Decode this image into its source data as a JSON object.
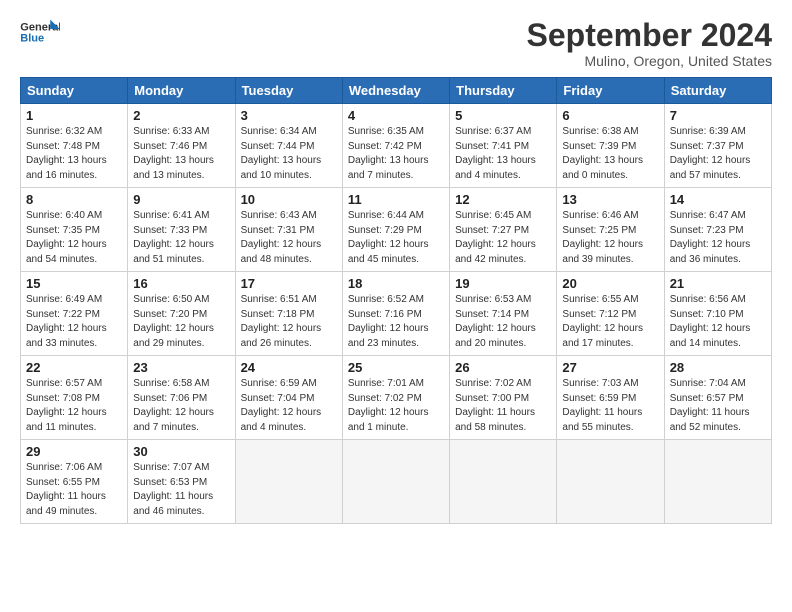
{
  "header": {
    "logo_general": "General",
    "logo_blue": "Blue",
    "month_title": "September 2024",
    "location": "Mulino, Oregon, United States"
  },
  "weekdays": [
    "Sunday",
    "Monday",
    "Tuesday",
    "Wednesday",
    "Thursday",
    "Friday",
    "Saturday"
  ],
  "weeks": [
    [
      {
        "day": "1",
        "info": "Sunrise: 6:32 AM\nSunset: 7:48 PM\nDaylight: 13 hours\nand 16 minutes."
      },
      {
        "day": "2",
        "info": "Sunrise: 6:33 AM\nSunset: 7:46 PM\nDaylight: 13 hours\nand 13 minutes."
      },
      {
        "day": "3",
        "info": "Sunrise: 6:34 AM\nSunset: 7:44 PM\nDaylight: 13 hours\nand 10 minutes."
      },
      {
        "day": "4",
        "info": "Sunrise: 6:35 AM\nSunset: 7:42 PM\nDaylight: 13 hours\nand 7 minutes."
      },
      {
        "day": "5",
        "info": "Sunrise: 6:37 AM\nSunset: 7:41 PM\nDaylight: 13 hours\nand 4 minutes."
      },
      {
        "day": "6",
        "info": "Sunrise: 6:38 AM\nSunset: 7:39 PM\nDaylight: 13 hours\nand 0 minutes."
      },
      {
        "day": "7",
        "info": "Sunrise: 6:39 AM\nSunset: 7:37 PM\nDaylight: 12 hours\nand 57 minutes."
      }
    ],
    [
      {
        "day": "8",
        "info": "Sunrise: 6:40 AM\nSunset: 7:35 PM\nDaylight: 12 hours\nand 54 minutes."
      },
      {
        "day": "9",
        "info": "Sunrise: 6:41 AM\nSunset: 7:33 PM\nDaylight: 12 hours\nand 51 minutes."
      },
      {
        "day": "10",
        "info": "Sunrise: 6:43 AM\nSunset: 7:31 PM\nDaylight: 12 hours\nand 48 minutes."
      },
      {
        "day": "11",
        "info": "Sunrise: 6:44 AM\nSunset: 7:29 PM\nDaylight: 12 hours\nand 45 minutes."
      },
      {
        "day": "12",
        "info": "Sunrise: 6:45 AM\nSunset: 7:27 PM\nDaylight: 12 hours\nand 42 minutes."
      },
      {
        "day": "13",
        "info": "Sunrise: 6:46 AM\nSunset: 7:25 PM\nDaylight: 12 hours\nand 39 minutes."
      },
      {
        "day": "14",
        "info": "Sunrise: 6:47 AM\nSunset: 7:23 PM\nDaylight: 12 hours\nand 36 minutes."
      }
    ],
    [
      {
        "day": "15",
        "info": "Sunrise: 6:49 AM\nSunset: 7:22 PM\nDaylight: 12 hours\nand 33 minutes."
      },
      {
        "day": "16",
        "info": "Sunrise: 6:50 AM\nSunset: 7:20 PM\nDaylight: 12 hours\nand 29 minutes."
      },
      {
        "day": "17",
        "info": "Sunrise: 6:51 AM\nSunset: 7:18 PM\nDaylight: 12 hours\nand 26 minutes."
      },
      {
        "day": "18",
        "info": "Sunrise: 6:52 AM\nSunset: 7:16 PM\nDaylight: 12 hours\nand 23 minutes."
      },
      {
        "day": "19",
        "info": "Sunrise: 6:53 AM\nSunset: 7:14 PM\nDaylight: 12 hours\nand 20 minutes."
      },
      {
        "day": "20",
        "info": "Sunrise: 6:55 AM\nSunset: 7:12 PM\nDaylight: 12 hours\nand 17 minutes."
      },
      {
        "day": "21",
        "info": "Sunrise: 6:56 AM\nSunset: 7:10 PM\nDaylight: 12 hours\nand 14 minutes."
      }
    ],
    [
      {
        "day": "22",
        "info": "Sunrise: 6:57 AM\nSunset: 7:08 PM\nDaylight: 12 hours\nand 11 minutes."
      },
      {
        "day": "23",
        "info": "Sunrise: 6:58 AM\nSunset: 7:06 PM\nDaylight: 12 hours\nand 7 minutes."
      },
      {
        "day": "24",
        "info": "Sunrise: 6:59 AM\nSunset: 7:04 PM\nDaylight: 12 hours\nand 4 minutes."
      },
      {
        "day": "25",
        "info": "Sunrise: 7:01 AM\nSunset: 7:02 PM\nDaylight: 12 hours\nand 1 minute."
      },
      {
        "day": "26",
        "info": "Sunrise: 7:02 AM\nSunset: 7:00 PM\nDaylight: 11 hours\nand 58 minutes."
      },
      {
        "day": "27",
        "info": "Sunrise: 7:03 AM\nSunset: 6:59 PM\nDaylight: 11 hours\nand 55 minutes."
      },
      {
        "day": "28",
        "info": "Sunrise: 7:04 AM\nSunset: 6:57 PM\nDaylight: 11 hours\nand 52 minutes."
      }
    ],
    [
      {
        "day": "29",
        "info": "Sunrise: 7:06 AM\nSunset: 6:55 PM\nDaylight: 11 hours\nand 49 minutes."
      },
      {
        "day": "30",
        "info": "Sunrise: 7:07 AM\nSunset: 6:53 PM\nDaylight: 11 hours\nand 46 minutes."
      },
      {
        "day": "",
        "info": ""
      },
      {
        "day": "",
        "info": ""
      },
      {
        "day": "",
        "info": ""
      },
      {
        "day": "",
        "info": ""
      },
      {
        "day": "",
        "info": ""
      }
    ]
  ]
}
